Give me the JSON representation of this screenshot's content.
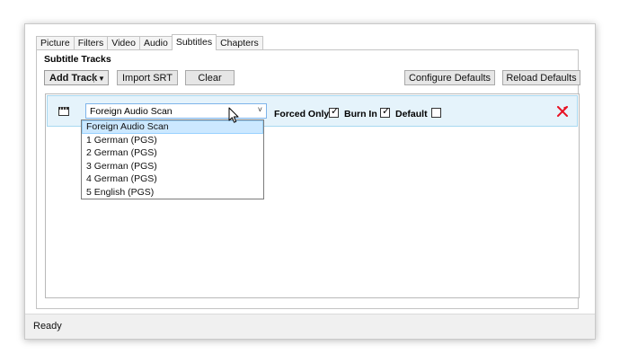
{
  "tabs": [
    {
      "label": "Picture",
      "active": false
    },
    {
      "label": "Filters",
      "active": false
    },
    {
      "label": "Video",
      "active": false
    },
    {
      "label": "Audio",
      "active": false
    },
    {
      "label": "Subtitles",
      "active": true
    },
    {
      "label": "Chapters",
      "active": false
    }
  ],
  "subtitles": {
    "group_title": "Subtitle Tracks",
    "add_track_label": "Add Track",
    "import_srt_label": "Import SRT",
    "clear_label": "Clear",
    "configure_defaults_label": "Configure Defaults",
    "reload_defaults_label": "Reload Defaults"
  },
  "track": {
    "selected_source": "Foreign Audio Scan",
    "forced_only_label": "Forced Only",
    "forced_only_checked": true,
    "burn_in_label": "Burn In",
    "burn_in_checked": true,
    "default_label": "Default",
    "default_checked": false
  },
  "dropdown": {
    "options": [
      "Foreign Audio Scan",
      "1 German (PGS)",
      "2 German (PGS)",
      "3 German (PGS)",
      "4 German (PGS)",
      "5 English (PGS)"
    ],
    "selected_index": 0
  },
  "status": {
    "text": "Ready"
  },
  "icons": {
    "subtitle_track": "subtitle-track-icon",
    "delete_track": "delete-track-icon",
    "combo_chevron": "chevron-down-icon",
    "split_arrow": "dropdown-arrow-icon",
    "checkmark": "checkmark-icon",
    "cursor": "mouse-cursor-icon"
  },
  "colors": {
    "track_row_bg": "#e5f3fb",
    "selection": "#cce8ff",
    "delete_red": "#e81123"
  }
}
